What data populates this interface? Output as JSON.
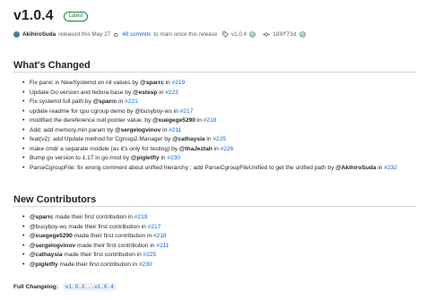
{
  "release": {
    "title": "v1.0.4",
    "badge": "Latest",
    "author": "AkihiroSuda",
    "released_text": "released this May 27",
    "commits_link": "48 commits",
    "commits_suffix": "to main since this release",
    "tag": "v1.0.4",
    "commit_hash": "188f73d"
  },
  "whats_changed": {
    "heading": "What's Changed",
    "items": [
      {
        "pre": "Fix panic in NewSystemd on nil values by ",
        "user": "@sparrc",
        "mid": " in ",
        "link": "#219"
      },
      {
        "pre": "Update Go version and fedora base by ",
        "user": "@estesp",
        "mid": " in ",
        "link": "#223"
      },
      {
        "pre": "Fix systemd full path by ",
        "user": "@sparrc",
        "mid": " in ",
        "link": "#221"
      },
      {
        "pre": "update readme for cpu cgroup demo by @busyboy-ws in ",
        "user": "",
        "mid": "",
        "link": "#217"
      },
      {
        "pre": "modified the dereference null pointer value. by ",
        "user": "@xuegege5290",
        "mid": " in ",
        "link": "#218"
      },
      {
        "pre": "Add: add memory.min param by ",
        "user": "@sergelogvinov",
        "mid": " in ",
        "link": "#211"
      },
      {
        "pre": "feat(v2): add Update method for Cgroup2.Manager by ",
        "user": "@cathaysia",
        "mid": " in ",
        "link": "#225"
      },
      {
        "pre": "make cmd/ a separate module (as it's only for testing) by ",
        "user": "@thaJeztah",
        "mid": " in ",
        "link": "#226"
      },
      {
        "pre": "Bump go version to 1.17 in go.mod by ",
        "user": "@pigletfly",
        "mid": " in ",
        "link": "#230"
      },
      {
        "pre": "ParseCgroupFile: fix wrong comment about unified hierarchy ; add ParseCgroupFileUnified to get the unified path by ",
        "user": "@AkihiroSuda",
        "mid": " in ",
        "link": "#232"
      }
    ]
  },
  "new_contributors": {
    "heading": "New Contributors",
    "items": [
      {
        "user": "@sparrc",
        "text": " made their first contribution in ",
        "link": "#219"
      },
      {
        "user": "@busyboy-ws",
        "text": " made their first contribution in ",
        "link": "#217"
      },
      {
        "user": "@xuegege5290",
        "text": " made their first contribution in ",
        "link": "#218"
      },
      {
        "user": "@sergelogvinov",
        "text": " made their first contribution in ",
        "link": "#211"
      },
      {
        "user": "@cathaysia",
        "text": " made their first contribution in ",
        "link": "#225"
      },
      {
        "user": "@pigletfly",
        "text": " made their first contribution in ",
        "link": "#230"
      }
    ]
  },
  "full_changelog": {
    "label": "Full Changelog:",
    "range": "v1.0.3...v1.0.4"
  },
  "icons": {
    "avatar": "avatar",
    "commits": "commit-icon",
    "tag": "tag-icon",
    "verified": "check-circle-icon",
    "hash": "git-commit-icon"
  },
  "colors": {
    "link": "#0969da",
    "badge_green": "#1a7f37",
    "text": "#1f2328",
    "muted": "#59636e"
  }
}
